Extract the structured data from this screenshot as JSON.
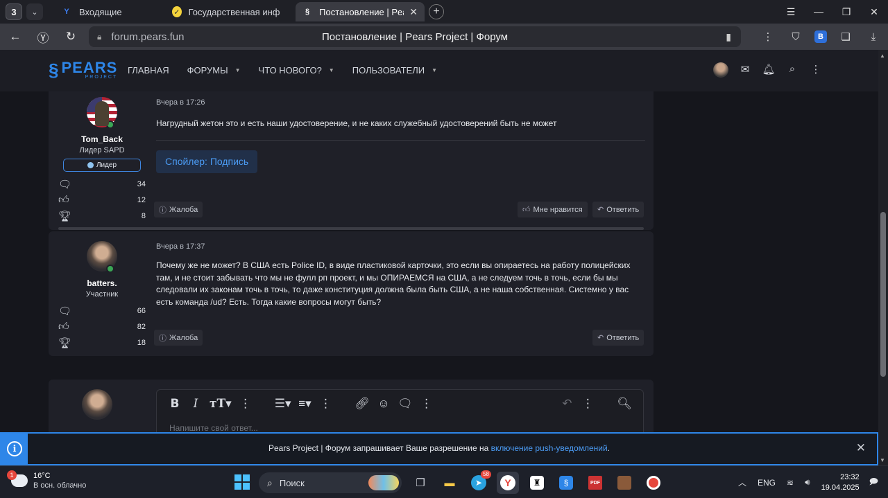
{
  "browser": {
    "tab_count": "3",
    "tabs": [
      {
        "label": "Входящие",
        "icon": "yandex-mail-icon",
        "active": false
      },
      {
        "label": "Государственная информ",
        "icon": "yellow-site-icon",
        "active": false
      },
      {
        "label": "Постановление | Pears",
        "icon": "pears-icon",
        "active": true
      }
    ],
    "url_host": "forum.pears.fun",
    "page_title": "Постановление | Pears Project | Форум"
  },
  "forum": {
    "logo_text": "PEARS",
    "logo_sub": "PROJECT",
    "menu": [
      "ГЛАВНАЯ",
      "ФОРУМЫ",
      "ЧТО НОВОГО?",
      "ПОЛЬЗОВАТЕЛИ"
    ],
    "accent": "#2e86e8"
  },
  "posts": [
    {
      "author": "Tom_Back",
      "title": "Лидер SAPD",
      "badge": "Лидер",
      "stats": [
        "34",
        "12",
        "8"
      ],
      "date": "Вчера в 17:26",
      "text": "Нагрудный жетон это и есть наши удостоверение, и не каких служебный удостоверений быть не может",
      "spoiler": "Спойлер: Подпись",
      "report": "Жалоба",
      "like": "Мне нравится",
      "reply": "Ответить"
    },
    {
      "author": "batters.",
      "title": "Участник",
      "stats": [
        "66",
        "82",
        "18"
      ],
      "date": "Вчера в 17:37",
      "text": "Почему же не может? В США есть Police ID, в виде пластиковой карточки, это если вы опираетесь на работу полицейских там, и не стоит забывать что мы не фулл рп проект, и мы ОПИРАЕМСЯ на США, а не следуем точь в точь, если бы мы следовали их законам точь в точь, то даже конституция должна была быть США, а не наша собственная. Системно у вас есть команда /ud? Есть. Тогда какие вопросы могут быть?",
      "report": "Жалоба",
      "reply": "Ответить"
    }
  ],
  "editor": {
    "placeholder": "Напишите свой ответ..."
  },
  "notification": {
    "text_before": "Pears Project | Форум запрашивает Ваше разрешение на ",
    "link": "включение push-уведомлений",
    "text_after": "."
  },
  "taskbar": {
    "weather_badge": "1",
    "temp": "16°C",
    "condition": "В осн. облачно",
    "search": "Поиск",
    "telegram_badge": "58",
    "lang": "ENG",
    "time": "23:32",
    "date": "19.04.2025"
  }
}
